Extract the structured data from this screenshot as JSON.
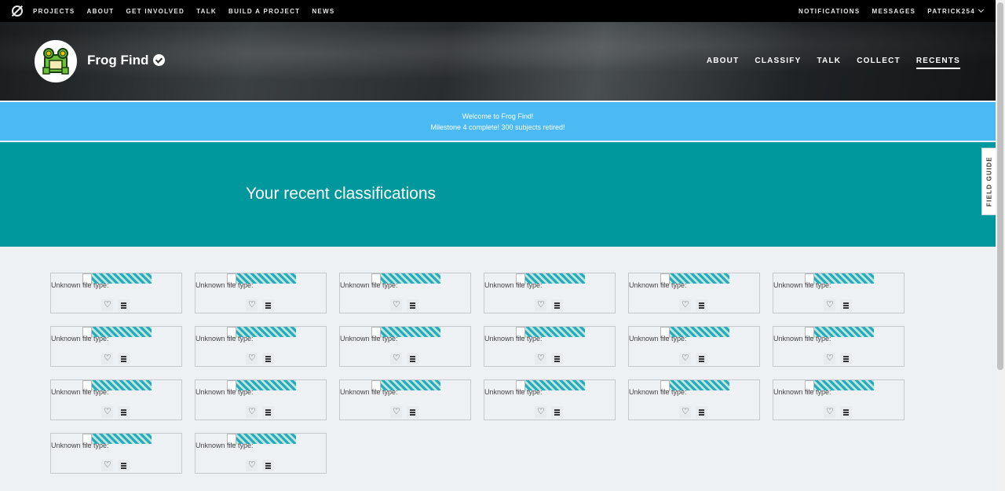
{
  "topnav": {
    "links": [
      "PROJECTS",
      "ABOUT",
      "GET INVOLVED",
      "TALK",
      "BUILD A PROJECT",
      "NEWS"
    ],
    "right_links": [
      "NOTIFICATIONS",
      "MESSAGES"
    ],
    "username": "PATRICK254"
  },
  "project": {
    "title": "Frog Find",
    "nav": [
      "ABOUT",
      "CLASSIFY",
      "TALK",
      "COLLECT",
      "RECENTS"
    ],
    "active_tab": "RECENTS"
  },
  "banner": {
    "line1": "Welcome to Frog Find!",
    "line2": "Milestone 4 complete! 300 subjects retired!"
  },
  "hero": {
    "title": "Your recent classifications"
  },
  "field_guide": {
    "label": "FIELD GUIDE"
  },
  "cards": {
    "file_type_label": "Unknown file type:",
    "count": 20,
    "icons": [
      "heart-icon",
      "list-icon"
    ]
  }
}
